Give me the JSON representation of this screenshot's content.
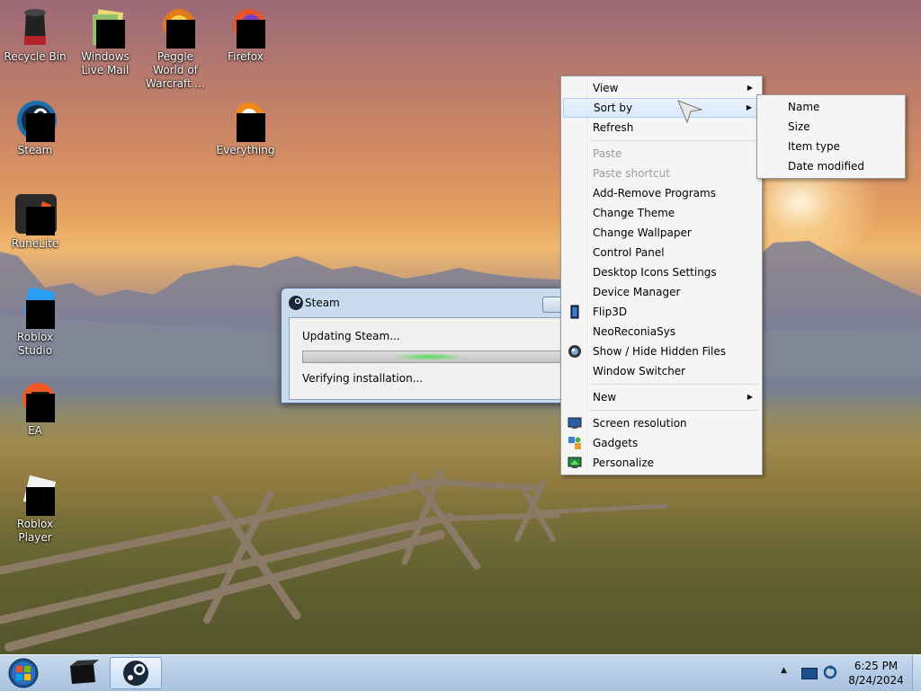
{
  "desktop": {
    "icons": [
      {
        "label": "Recycle Bin"
      },
      {
        "label": "Windows Live Mail"
      },
      {
        "label": "Peggle World of Warcraft ..."
      },
      {
        "label": "Firefox"
      },
      {
        "label": "Steam"
      },
      {
        "label": "Everything"
      },
      {
        "label": "RuneLite"
      },
      {
        "label": "Roblox Studio"
      },
      {
        "label": "EA"
      },
      {
        "label": "Roblox Player"
      }
    ]
  },
  "steam_window": {
    "title": "Steam",
    "status_line1": "Updating Steam...",
    "status_line2": "Verifying installation..."
  },
  "context_menu": {
    "items": [
      {
        "label": "View",
        "submenu": true
      },
      {
        "label": "Sort by",
        "submenu": true,
        "highlighted": true
      },
      {
        "label": "Refresh"
      },
      {
        "label": "Paste",
        "disabled": true
      },
      {
        "label": "Paste shortcut",
        "disabled": true
      },
      {
        "label": "Add-Remove Programs"
      },
      {
        "label": "Change Theme"
      },
      {
        "label": "Change Wallpaper"
      },
      {
        "label": "Control Panel"
      },
      {
        "label": "Desktop Icons Settings"
      },
      {
        "label": "Device Manager"
      },
      {
        "label": "Flip3D",
        "icon": "flip3d-icon"
      },
      {
        "label": "NeoReconiaSys"
      },
      {
        "label": "Show / Hide Hidden Files",
        "icon": "hidden-files-icon"
      },
      {
        "label": "Window Switcher"
      },
      {
        "label": "New",
        "submenu": true
      },
      {
        "label": "Screen resolution",
        "icon": "display-icon"
      },
      {
        "label": "Gadgets",
        "icon": "gadgets-icon"
      },
      {
        "label": "Personalize",
        "icon": "personalize-icon"
      }
    ]
  },
  "sort_by_menu": {
    "items": [
      {
        "label": "Name"
      },
      {
        "label": "Size"
      },
      {
        "label": "Item type"
      },
      {
        "label": "Date modified"
      }
    ]
  },
  "taskbar": {
    "clock_time": "6:25 PM",
    "clock_date": "8/24/2024",
    "tray_arrow": "▲"
  },
  "colors": {
    "menu_highlight": "#d9e9fc",
    "taskbar": "#b7cde6",
    "progress_glow": "#4ee04e"
  }
}
